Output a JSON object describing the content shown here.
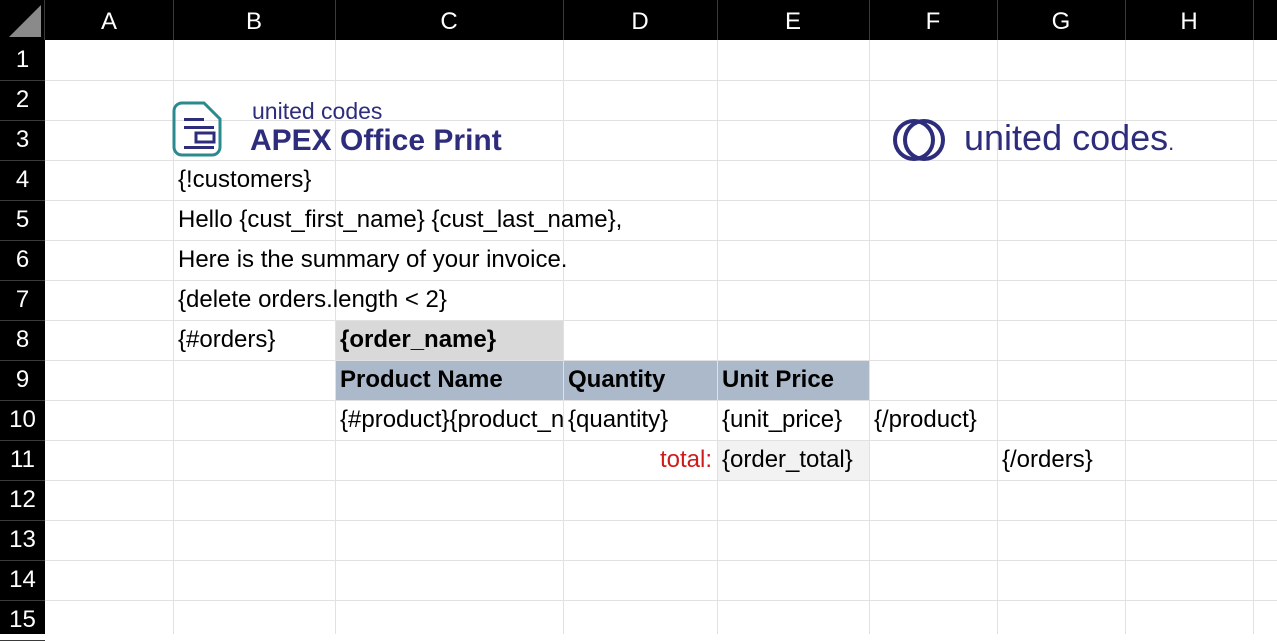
{
  "columns": [
    "A",
    "B",
    "C",
    "D",
    "E",
    "F",
    "G",
    "H"
  ],
  "rows": [
    "1",
    "2",
    "3",
    "4",
    "5",
    "6",
    "7",
    "8",
    "9",
    "10",
    "11",
    "12",
    "13",
    "14",
    "15"
  ],
  "logo_aop": {
    "top_text": "united codes",
    "main_text": "APEX Office Print"
  },
  "logo_uc": {
    "text": "united codes",
    "dot": "."
  },
  "cells": {
    "B4": "{!customers}",
    "B5": "Hello {cust_first_name} {cust_last_name},",
    "B6": "Here is the summary of your invoice.",
    "B7": "{delete orders.length < 2}",
    "B8": "{#orders}",
    "C8": "{order_name}",
    "C9": "Product Name",
    "D9": "Quantity",
    "E9": "Unit Price",
    "C10": "{#product}{product_name}",
    "D10": "{quantity}",
    "E10": "{unit_price}",
    "F10": "{/product}",
    "D11": "total:",
    "E11": "{order_total}",
    "G11": "{/orders}"
  },
  "colors": {
    "header_bg": "#000000",
    "order_name_fill": "#d9d9d9",
    "table_header_fill": "#acb9ca",
    "total_cell_fill": "#f2f2f2",
    "total_label": "#d11b1b",
    "logo_navy": "#2e2d7c",
    "logo_teal": "#2a8a8e"
  }
}
